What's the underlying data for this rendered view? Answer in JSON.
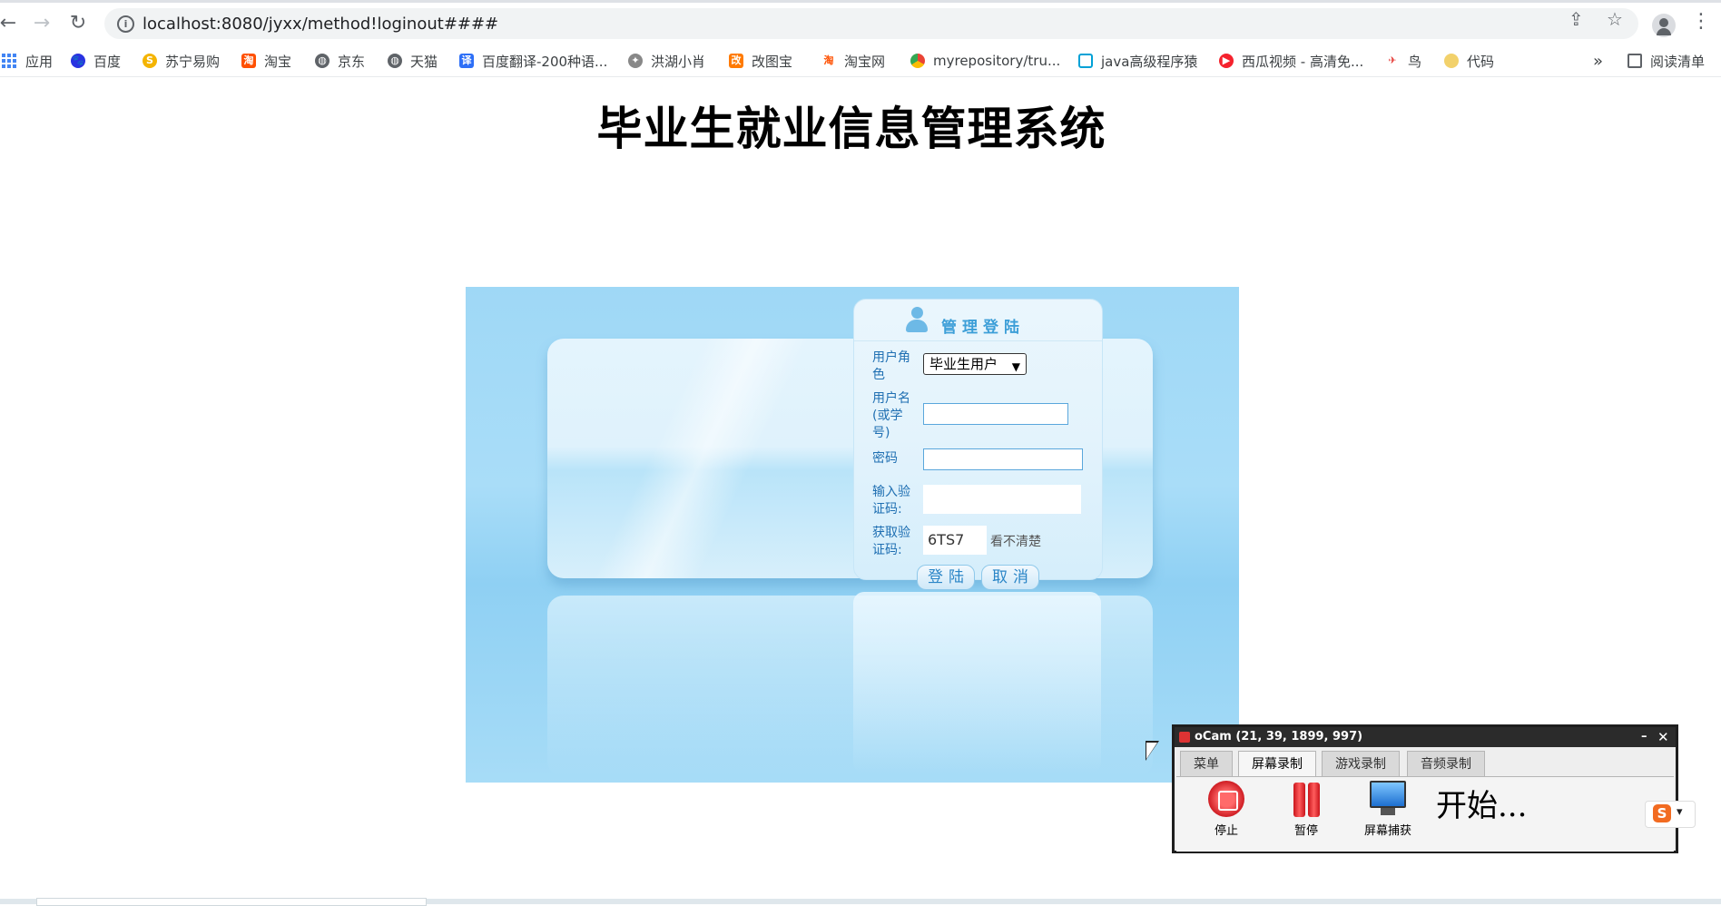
{
  "browser": {
    "url": "localhost:8080/jyxx/method!loginout####",
    "bookmarks": [
      {
        "label": "应用",
        "color": "#4285f4"
      },
      {
        "label": "百度",
        "color": "#2932e1"
      },
      {
        "label": "苏宁易购",
        "color": "#f4b400"
      },
      {
        "label": "淘宝",
        "color": "#ff5000"
      },
      {
        "label": "京东",
        "color": "#5f6368"
      },
      {
        "label": "天猫",
        "color": "#5f6368"
      },
      {
        "label": "百度翻译-200种语...",
        "color": "#2d6ff7"
      },
      {
        "label": "洪湖小肖",
        "color": "#888888"
      },
      {
        "label": "改图宝",
        "color": "#ff7a00"
      },
      {
        "label": "淘宝网",
        "color": "#ff5000"
      },
      {
        "label": "myrepository/tru...",
        "color": "#34a853"
      },
      {
        "label": "java高级程序猿",
        "color": "#00a1d6"
      },
      {
        "label": "西瓜视频 - 高清免...",
        "color": "#f5222d"
      },
      {
        "label": "鸟",
        "color": "#e53935"
      },
      {
        "label": "代码",
        "color": "#f2d16b"
      }
    ],
    "reading_list": "阅读清单",
    "overflow": "»"
  },
  "page": {
    "title": "毕业生就业信息管理系统"
  },
  "login": {
    "header": "管理登陆",
    "role_label": "用户角色",
    "role_value": "毕业生用户",
    "username_label": "用户名(或学号)",
    "username_value": "",
    "password_label": "密码",
    "password_value": "",
    "captcha_input_label": "输入验证码:",
    "captcha_input_value": "",
    "captcha_get_label": "获取验证码:",
    "captcha_code": "6TS7",
    "captcha_refresh": "看不清楚",
    "login_button": "登陆",
    "cancel_button": "取消"
  },
  "ocam": {
    "title": "oCam (21, 39, 1899, 997)",
    "tabs": [
      "菜单",
      "屏幕录制",
      "游戏录制",
      "音频录制"
    ],
    "active_tab": "屏幕录制",
    "tools": {
      "stop": "停止",
      "pause": "暂停",
      "capture": "屏幕捕获"
    },
    "status": "开始..."
  },
  "colors": {
    "accent": "#3d9fd8",
    "login_bg": "#a4dbf7"
  }
}
